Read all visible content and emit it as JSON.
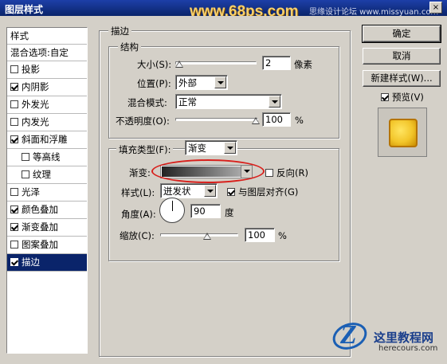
{
  "window": {
    "title": "图层样式",
    "watermark_text": "www.68ps.com",
    "site_tag": "思缘设计论坛 www.missyuan.com",
    "close_label": "×"
  },
  "sidebar": {
    "header": "样式",
    "blend_options": "混合选项:自定",
    "items": [
      {
        "label": "投影",
        "checked": false
      },
      {
        "label": "内阴影",
        "checked": true
      },
      {
        "label": "外发光",
        "checked": false
      },
      {
        "label": "内发光",
        "checked": false
      },
      {
        "label": "斜面和浮雕",
        "checked": true
      },
      {
        "label": "等高线",
        "checked": false
      },
      {
        "label": "纹理",
        "checked": false
      },
      {
        "label": "光泽",
        "checked": false
      },
      {
        "label": "颜色叠加",
        "checked": true
      },
      {
        "label": "渐变叠加",
        "checked": true
      },
      {
        "label": "图案叠加",
        "checked": false
      },
      {
        "label": "描边",
        "checked": true
      }
    ]
  },
  "stroke": {
    "title": "描边",
    "structure_title": "结构",
    "size_label": "大小(S):",
    "size_value": "2",
    "size_unit": "像素",
    "position_label": "位置(P):",
    "position_value": "外部",
    "blend_mode_label": "混合模式:",
    "blend_mode_value": "正常",
    "opacity_label": "不透明度(O):",
    "opacity_value": "100",
    "opacity_unit": "%",
    "fill_type_label": "填充类型(F):",
    "fill_type_value": "渐变",
    "gradient_label": "渐变:",
    "reverse_label": "反向(R)",
    "reverse_checked": false,
    "style_label": "样式(L):",
    "style_value": "迸发状",
    "align_label": "与图层对齐(G)",
    "align_checked": true,
    "angle_label": "角度(A):",
    "angle_value": "90",
    "angle_unit": "度",
    "scale_label": "缩放(C):",
    "scale_value": "100",
    "scale_unit": "%"
  },
  "buttons": {
    "ok": "确定",
    "cancel": "取消",
    "new_style": "新建样式(W)...",
    "preview_label": "预览(V)",
    "preview_checked": true
  },
  "logo": {
    "mark": "Z",
    "cn": "这里教程网",
    "en": "herecours.com"
  }
}
